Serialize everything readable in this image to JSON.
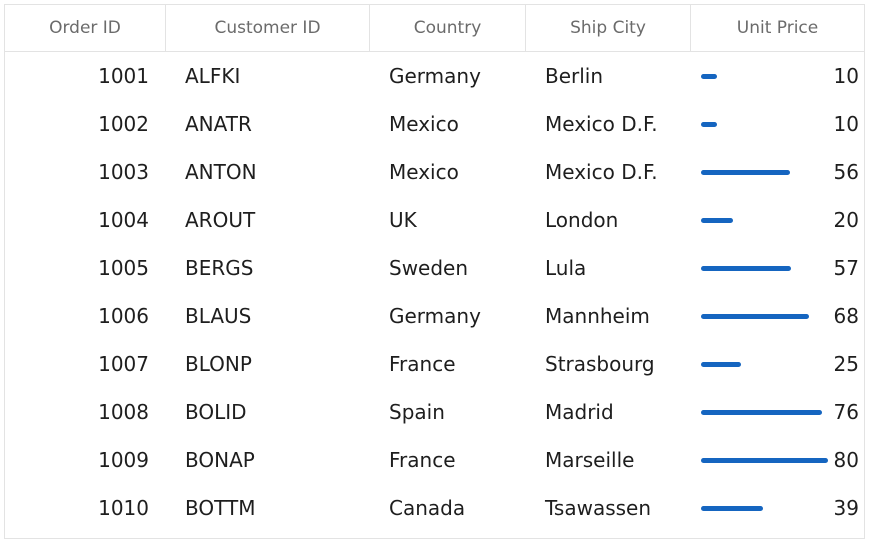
{
  "columns": {
    "order_id": "Order ID",
    "customer_id": "Customer ID",
    "country": "Country",
    "ship_city": "Ship City",
    "unit_price": "Unit Price"
  },
  "unit_price_scale_max": 80,
  "bar_color": "#1565c0",
  "rows": [
    {
      "order_id": "1001",
      "customer_id": "ALFKI",
      "country": "Germany",
      "ship_city": "Berlin",
      "unit_price": "10"
    },
    {
      "order_id": "1002",
      "customer_id": "ANATR",
      "country": "Mexico",
      "ship_city": "Mexico D.F.",
      "unit_price": "10"
    },
    {
      "order_id": "1003",
      "customer_id": "ANTON",
      "country": "Mexico",
      "ship_city": "Mexico D.F.",
      "unit_price": "56"
    },
    {
      "order_id": "1004",
      "customer_id": "AROUT",
      "country": "UK",
      "ship_city": "London",
      "unit_price": "20"
    },
    {
      "order_id": "1005",
      "customer_id": "BERGS",
      "country": "Sweden",
      "ship_city": "Lula",
      "unit_price": "57"
    },
    {
      "order_id": "1006",
      "customer_id": "BLAUS",
      "country": "Germany",
      "ship_city": "Mannheim",
      "unit_price": "68"
    },
    {
      "order_id": "1007",
      "customer_id": "BLONP",
      "country": "France",
      "ship_city": "Strasbourg",
      "unit_price": "25"
    },
    {
      "order_id": "1008",
      "customer_id": "BOLID",
      "country": "Spain",
      "ship_city": "Madrid",
      "unit_price": "76"
    },
    {
      "order_id": "1009",
      "customer_id": "BONAP",
      "country": "France",
      "ship_city": "Marseille",
      "unit_price": "80"
    },
    {
      "order_id": "1010",
      "customer_id": "BOTTM",
      "country": "Canada",
      "ship_city": "Tsawassen",
      "unit_price": "39"
    }
  ]
}
